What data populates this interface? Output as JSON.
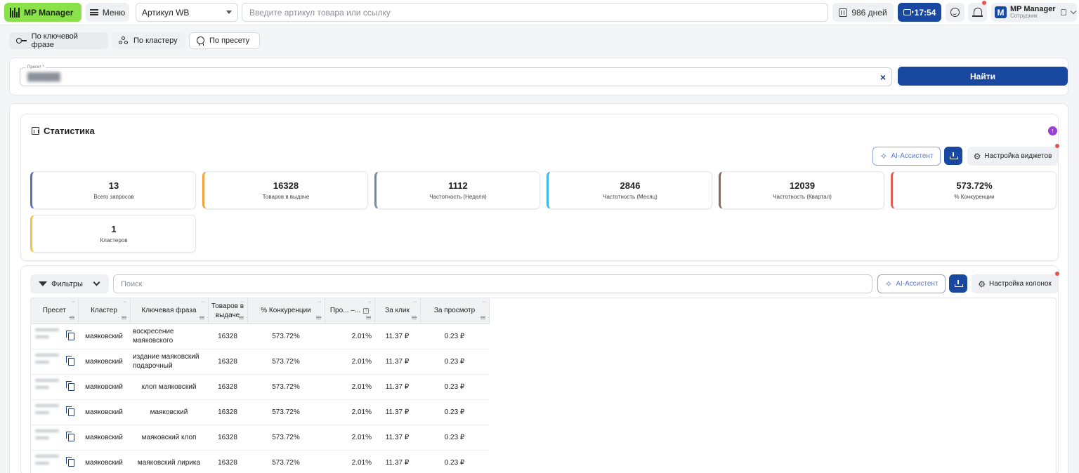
{
  "header": {
    "logo_label": "MP Manager",
    "menu_label": "Меню",
    "article_select_value": "Артикул WB",
    "search_placeholder": "Введите артикул товара или ссылку",
    "days_label": "986 дней",
    "time_label": "17:54",
    "user_initial": "M",
    "user_name": "MP Manager",
    "user_role": "Сотрудник"
  },
  "modes": [
    {
      "label": "По ключевой фразе",
      "icon": "key-icon"
    },
    {
      "label": "По кластеру",
      "icon": "cluster-icon"
    },
    {
      "label": "По пресету",
      "icon": "medal-icon"
    }
  ],
  "preset": {
    "legend": "Пресет *",
    "value": "██████",
    "clear_glyph": "×",
    "find_label": "Найти"
  },
  "stats": {
    "title": "Статистика",
    "ai_label": "AI-Ассистент",
    "widgets_label": "Настройка виджетов",
    "tiles": [
      {
        "value": "13",
        "label": "Всего запросов",
        "color": "#5b6fbf"
      },
      {
        "value": "16328",
        "label": "Товаров в выдаче",
        "color": "#f0a43c"
      },
      {
        "value": "1112",
        "label": "Частотность (Неделя)",
        "color": "#6e8aa3"
      },
      {
        "value": "2846",
        "label": "Частотность (Месяц)",
        "color": "#3fb5e8"
      },
      {
        "value": "12039",
        "label": "Частотность (Квартал)",
        "color": "#8a6a5e"
      },
      {
        "value": "573.72%",
        "label": "% Конкуренции",
        "color": "#e0605a"
      },
      {
        "value": "1",
        "label": "Кластеров",
        "color": "#f3c440"
      }
    ]
  },
  "table": {
    "filters_label": "Фильтры",
    "search_placeholder": "Поиск",
    "ai_label": "AI-Ассистент",
    "columns_label": "Настройка колонок",
    "headers": [
      "Пресет",
      "Кластер",
      "Ключевая фраза",
      "Товаров в выдаче",
      "% Конкуренции",
      "Про... –...",
      "За клик",
      "За просмотр"
    ],
    "rows": [
      {
        "cluster": "маяковский",
        "phrase": "воскресение маяковского",
        "goods": "16328",
        "competition": "573.72%",
        "pro": "2.01%",
        "click": "11.37 ₽",
        "view": "0.23 ₽"
      },
      {
        "cluster": "маяковский",
        "phrase": "издание маяковский подарочный",
        "goods": "16328",
        "competition": "573.72%",
        "pro": "2.01%",
        "click": "11.37 ₽",
        "view": "0.23 ₽"
      },
      {
        "cluster": "маяковский",
        "phrase": "клоп маяковский",
        "goods": "16328",
        "competition": "573.72%",
        "pro": "2.01%",
        "click": "11.37 ₽",
        "view": "0.23 ₽"
      },
      {
        "cluster": "маяковский",
        "phrase": "маяковский",
        "goods": "16328",
        "competition": "573.72%",
        "pro": "2.01%",
        "click": "11.37 ₽",
        "view": "0.23 ₽"
      },
      {
        "cluster": "маяковский",
        "phrase": "маяковский клоп",
        "goods": "16328",
        "competition": "573.72%",
        "pro": "2.01%",
        "click": "11.37 ₽",
        "view": "0.23 ₽"
      },
      {
        "cluster": "маяковский",
        "phrase": "маяковский лирика",
        "goods": "16328",
        "competition": "573.72%",
        "pro": "2.01%",
        "click": "11.37 ₽",
        "view": "0.23 ₽"
      }
    ]
  },
  "colors": {
    "brand_green": "#8ae14a",
    "primary_blue": "#1848a0",
    "ai_purple": "#9b3fd2"
  }
}
